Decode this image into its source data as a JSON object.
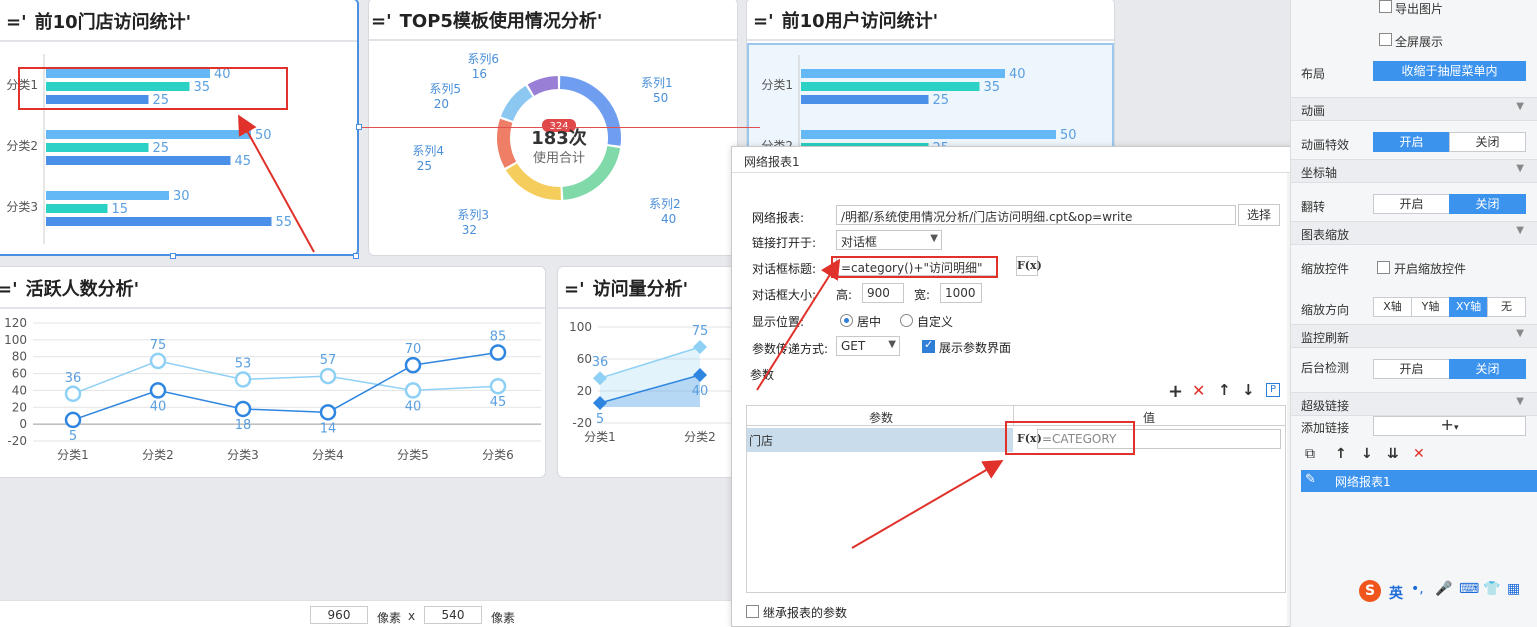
{
  "canvas": {
    "top_left_text": "像素",
    "panels": [
      {
        "id": "store",
        "title": "前10门店访问统计"
      },
      {
        "id": "template",
        "title": "TOP5模板使用情况分析"
      },
      {
        "id": "user",
        "title": "前10用户访问统计"
      },
      {
        "id": "active",
        "title": "活跃人数分析"
      },
      {
        "id": "visits",
        "title": "访问量分析"
      }
    ],
    "title_prefix": "=",
    "title_quote": "'",
    "donut_badge": "324",
    "donut_center_value": "183次",
    "donut_center_label": "使用合计"
  },
  "chart_data": [
    {
      "type": "bar",
      "panel": "前10门店访问统计",
      "orientation": "horizontal",
      "categories": [
        "分类1",
        "分类2",
        "分类3"
      ],
      "series": [
        {
          "values": [
            40,
            50,
            30
          ],
          "color": "#63b8f5"
        },
        {
          "values": [
            35,
            25,
            15
          ],
          "color": "#2bd1c4"
        },
        {
          "values": [
            25,
            45,
            55
          ],
          "color": "#4a8fe8"
        }
      ]
    },
    {
      "type": "pie",
      "panel": "TOP5模板使用情况分析",
      "series": [
        {
          "name": "系列1",
          "value": 50,
          "color": "#6f9ef0"
        },
        {
          "name": "系列2",
          "value": 40,
          "color": "#7fd9a9"
        },
        {
          "name": "系列3",
          "value": 32,
          "color": "#f5cd5c"
        },
        {
          "name": "系列4",
          "value": 25,
          "color": "#ee7e66"
        },
        {
          "name": "系列5",
          "value": 20,
          "color": "#8cc7f2"
        },
        {
          "name": "系列6",
          "value": 16,
          "color": "#9a7fd6"
        }
      ]
    },
    {
      "type": "bar",
      "panel": "前10用户访问统计",
      "orientation": "horizontal",
      "categories": [
        "分类1",
        "分类2"
      ],
      "series": [
        {
          "values": [
            40,
            50
          ],
          "color": "#63b8f5"
        },
        {
          "values": [
            35,
            25
          ],
          "color": "#2bd1c4"
        },
        {
          "values": [
            25,
            null
          ],
          "color": "#4a8fe8"
        }
      ]
    },
    {
      "type": "line",
      "panel": "活跃人数分析",
      "categories": [
        "分类1",
        "分类2",
        "分类3",
        "分类4",
        "分类5",
        "分类6"
      ],
      "yticks": [
        "120",
        "100",
        "80",
        "60",
        "40",
        "20",
        "0",
        "-20"
      ],
      "ylim": [
        -20,
        120
      ],
      "series": [
        {
          "values": [
            36,
            75,
            53,
            57,
            40,
            45
          ],
          "color": "#8fd0f5"
        },
        {
          "values": [
            5,
            40,
            18,
            14,
            70,
            85
          ],
          "color": "#2f86e0"
        }
      ]
    },
    {
      "type": "area",
      "panel": "访问量分析",
      "categories": [
        "分类1",
        "分类2"
      ],
      "yticks": [
        "100",
        "60",
        "20",
        "-20"
      ],
      "ylim": [
        -20,
        100
      ],
      "series": [
        {
          "values": [
            36,
            75
          ],
          "color": "#8fd0f5"
        },
        {
          "values": [
            5,
            40
          ],
          "color": "#2f86e0"
        }
      ]
    }
  ],
  "size_bar": {
    "width": "960",
    "unit1": "像素",
    "x": "x",
    "height": "540",
    "unit2": "像素"
  },
  "dialog": {
    "title": "网络报表1",
    "report_label": "网络报表:",
    "report_value": "/明都/系统使用情况分析/门店访问明细.cpt&op=write",
    "select_button": "选择",
    "open_in_label": "链接打开于:",
    "open_in_value": "对话框",
    "dialog_title_label": "对话框标题:",
    "dialog_title_value": "=category()+\"访问明细\"",
    "fx_label": "F(x)",
    "size_label": "对话框大小:",
    "height_label": "高:",
    "height_value": "900",
    "width_label": "宽:",
    "width_value": "1000",
    "position_label": "显示位置:",
    "position_center": "居中",
    "position_custom": "自定义",
    "param_method_label": "参数传递方式:",
    "param_method_value": "GET",
    "show_param_ui": "展示参数界面",
    "params_label": "参数",
    "table_headers": [
      "参数",
      "值"
    ],
    "table_rows": [
      {
        "param": "门店",
        "value": "=CATEGORY"
      }
    ],
    "toolbar_p": "P",
    "inherit_params": "继承报表的参数"
  },
  "right_panel": {
    "export_image": "导出图片",
    "fullscreen": "全屏展示",
    "layout_label": "布局",
    "layout_value": "收缩于抽屉菜单内",
    "anim_section": "动画",
    "anim_label": "动画特效",
    "on": "开启",
    "off": "关闭",
    "axis_section": "坐标轴",
    "flip_label": "翻转",
    "zoom_section": "图表缩放",
    "zoom_ctrl_label": "缩放控件",
    "zoom_ctrl_check": "开启缩放控件",
    "zoom_dir_label": "缩放方向",
    "zoom_dirs": [
      "X轴",
      "Y轴",
      "XY轴",
      "无"
    ],
    "monitor_section": "监控刷新",
    "bg_detect_label": "后台检测",
    "link_section": "超级链接",
    "add_link_label": "添加链接",
    "link_item": "网络报表1",
    "ime_text": "英"
  }
}
